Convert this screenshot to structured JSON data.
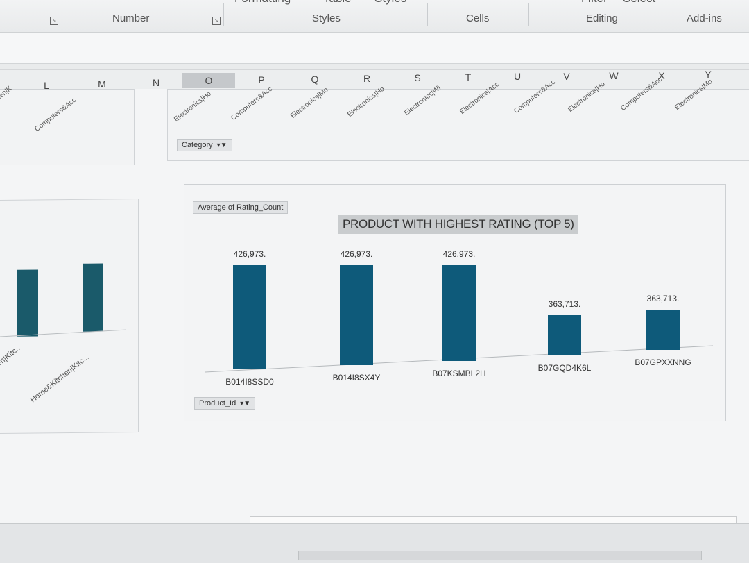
{
  "ribbon": {
    "top_fragments": [
      "Formatting",
      "Table",
      "Styles",
      "Filter",
      "Select"
    ],
    "groups": [
      "Number",
      "Styles",
      "Cells",
      "Editing",
      "Add-ins"
    ]
  },
  "columns": [
    "L",
    "M",
    "N",
    "O",
    "P",
    "Q",
    "R",
    "S",
    "T",
    "U",
    "V",
    "W",
    "X",
    "Y"
  ],
  "selected_column": "O",
  "left_top_chart": {
    "labels": [
      "chen|K",
      "Computers&Acc"
    ]
  },
  "category_chart": {
    "labels": [
      "Electronics|Ho",
      "Computers&Acc",
      "Electronics|Mo",
      "Electronics|Ho",
      "Electronics|Wi",
      "Electronics|Acc",
      "Computers&Acc",
      "Electronics|Ho",
      "Computers&Acc",
      "Electronics|Mo"
    ],
    "field_button": "Category"
  },
  "left_bottom_chart": {
    "labels": [
      "chen|Kitc...",
      "Home&Kitchen|Kitc..."
    ]
  },
  "chart_data": {
    "type": "bar",
    "title": "PRODUCT WITH HIGHEST RATING (TOP 5)",
    "value_field_button": "Average of Rating_Count",
    "axis_field_button": "Product_Id",
    "categories": [
      "B014I8SSD0",
      "B014I8SX4Y",
      "B07KSMBL2H",
      "B07GQD4K6L",
      "B07GPXXNNG"
    ],
    "values": [
      426973,
      426973,
      426973,
      363713,
      363713
    ],
    "data_labels": [
      "426,973.",
      "426,973.",
      "426,973.",
      "363,713.",
      "363,713."
    ],
    "bar_color": "#0e5a7a",
    "ylim": [
      0,
      426973
    ]
  }
}
